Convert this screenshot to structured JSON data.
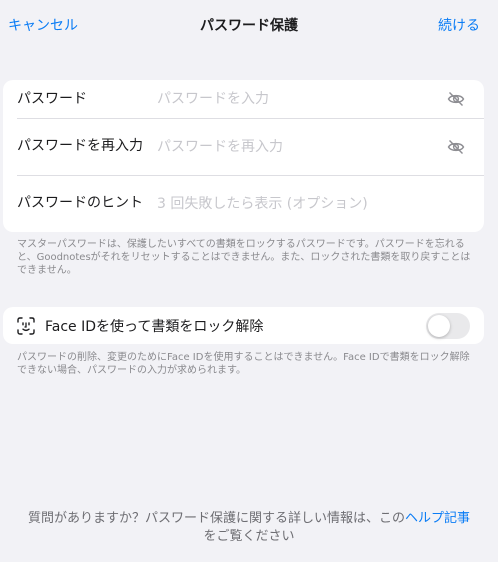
{
  "nav": {
    "cancel": "キャンセル",
    "title": "パスワード保護",
    "continue": "続ける"
  },
  "password_form": {
    "rows": [
      {
        "label": "パスワード",
        "placeholder": "パスワードを入力",
        "value": ""
      },
      {
        "label": "パスワードを再入力",
        "placeholder": "パスワードを再入力",
        "value": ""
      },
      {
        "label": "パスワードのヒント",
        "placeholder": "3 回失敗したら表示 (オプション)",
        "value": ""
      }
    ],
    "footnote": "マスターパスワードは、保護したいすべての書類をロックするパスワードです。パスワードを忘れると、Goodnotesがそれをリセットすることはできません。また、ロックされた書類を取り戻すことはできません。"
  },
  "face_id": {
    "label": "Face IDを使って書類をロック解除",
    "enabled": false,
    "footnote": "パスワードの削除、変更のためにFace IDを使用することはできません。Face IDで書類をロック解除できない場合、パスワードの入力が求められます。"
  },
  "help": {
    "text": "質問がありますか？パスワード保護に関する詳しい情報は、この",
    "link": "ヘルプ記事",
    "suffix": "をご覧ください"
  },
  "colors": {
    "accent": "#0a7cf5",
    "background": "#f2f2f6",
    "card": "#ffffff",
    "secondary_text": "#8a8a8e"
  },
  "icons": [
    "eye-slash-icon",
    "face-id-icon"
  ]
}
